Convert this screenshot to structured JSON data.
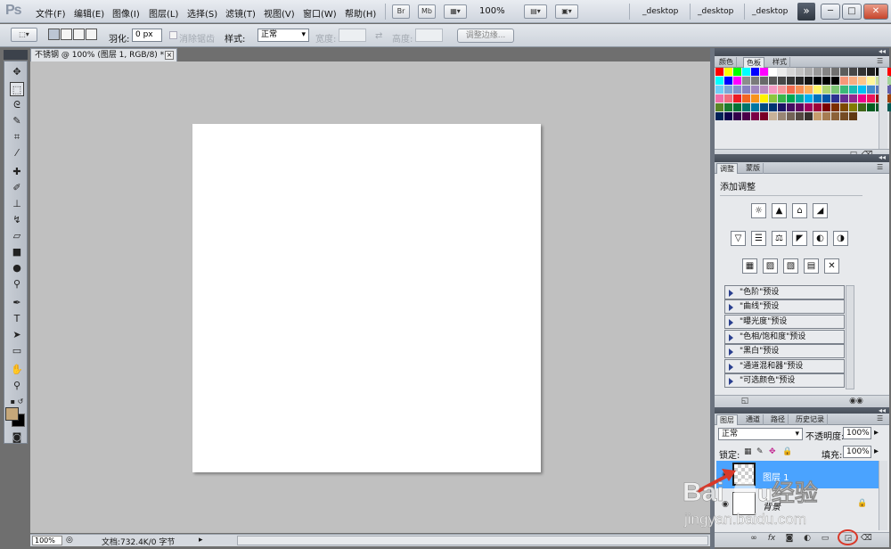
{
  "app": {
    "logo": "Ps"
  },
  "menu": {
    "items": [
      "文件(F)",
      "编辑(E)",
      "图像(I)",
      "图层(L)",
      "选择(S)",
      "滤镜(T)",
      "视图(V)",
      "窗口(W)",
      "帮助(H)"
    ],
    "bridge": "Br",
    "minibridge": "Mb",
    "zoom": "100%",
    "workspaces": [
      "_desktop",
      "_desktop",
      "_desktop"
    ],
    "expander": "»",
    "window_buttons": [
      "─",
      "□",
      "✕"
    ]
  },
  "options": {
    "feather_label": "羽化:",
    "feather_value": "0 px",
    "antialias_label": "消除锯齿",
    "style_label": "样式:",
    "style_value": "正常",
    "width_label": "宽度:",
    "height_label": "高度:",
    "refine_button": "调整边缘..."
  },
  "document": {
    "tab_title": "不锈钢 @ 100% (图层 1, RGB/8) *",
    "close_glyph": "×",
    "status_zoom": "100%",
    "status_doc": "文档:732.4K/0 字节",
    "status_arrow": "▸"
  },
  "swatches_panel": {
    "tabs": [
      "颜色",
      "色板",
      "样式"
    ],
    "active_tab": 1,
    "colors": [
      "#ff0000",
      "#ffff00",
      "#00ff00",
      "#00ffff",
      "#0000ff",
      "#ff00ff",
      "#ffffff",
      "#ebebeb",
      "#d6d6d6",
      "#c2c2c2",
      "#adadad",
      "#999999",
      "#858585",
      "#707070",
      "#5c5c5c",
      "#474747",
      "#333333",
      "#1f1f1f",
      "#000000",
      "#ff0000",
      "#ffff00",
      "#00ff00",
      "#00ffff",
      "#0000ff",
      "#ff00ff",
      "#8c8c8c",
      "#7a7a7a",
      "#696969",
      "#575757",
      "#474747",
      "#363636",
      "#262626",
      "#141414",
      "#000000",
      "#000000",
      "#000000",
      "#f7977a",
      "#f9ad81",
      "#fdc68a",
      "#fff79a",
      "#c4df9b",
      "#a3d39c",
      "#82ca9d",
      "#7bcdc8",
      "#6ecff6",
      "#7ea7d8",
      "#8493ca",
      "#8882be",
      "#a187be",
      "#bc8dbf",
      "#f49ac2",
      "#f6989d",
      "#f26c4f",
      "#f68e55",
      "#fbaf5c",
      "#fff467",
      "#acd372",
      "#7cc576",
      "#3bb878",
      "#1abbb4",
      "#00bff3",
      "#438ccb",
      "#5574b9",
      "#605ca8",
      "#855fa8",
      "#a763a8",
      "#f06ea9",
      "#f26d7d",
      "#ed1c24",
      "#f26522",
      "#f7941d",
      "#fff200",
      "#8dc63f",
      "#39b54a",
      "#00a651",
      "#00a99d",
      "#00aeef",
      "#0072bc",
      "#0054a6",
      "#2e3192",
      "#662d91",
      "#92278f",
      "#ec008c",
      "#ed145b",
      "#9e0b0f",
      "#a0410d",
      "#a36209",
      "#aba000",
      "#598527",
      "#1a7b30",
      "#007236",
      "#00746b",
      "#0076a3",
      "#004b80",
      "#003471",
      "#1b1464",
      "#440e62",
      "#630460",
      "#9e005d",
      "#9e0039",
      "#790000",
      "#7b2e00",
      "#7d4900",
      "#827b00",
      "#406618",
      "#005e20",
      "#005826",
      "#005952",
      "#005b7f",
      "#003663",
      "#002157",
      "#0d004c",
      "#32004b",
      "#4b0049",
      "#7b0046",
      "#7a0026",
      "#c7b299",
      "#998675",
      "#736357",
      "#534741",
      "#37302d",
      "#c69c6d",
      "#a67c52",
      "#8c6239",
      "#754c24",
      "#603913"
    ],
    "footer_icons": [
      "new-swatch",
      "delete-swatch"
    ]
  },
  "adjustments_panel": {
    "tabs": [
      "调整",
      "蒙版"
    ],
    "active_tab": 0,
    "title": "添加调整",
    "icon_rows": [
      [
        "☼",
        "▲",
        "⌂",
        "◢"
      ],
      [
        "▽",
        "☰",
        "⚖",
        "◤",
        "◐",
        "◑"
      ],
      [
        "▦",
        "▨",
        "▧",
        "▤",
        "✕"
      ]
    ],
    "presets": [
      "\"色阶\"预设",
      "\"曲线\"预设",
      "\"曝光度\"预设",
      "\"色相/饱和度\"预设",
      "\"黑白\"预设",
      "\"通道混和器\"预设",
      "\"可选颜色\"预设"
    ]
  },
  "layers_panel": {
    "tabs": [
      "图层",
      "通道",
      "路径",
      "历史记录"
    ],
    "active_tab": 0,
    "blend_mode": "正常",
    "opacity_label": "不透明度:",
    "opacity_value": "100%",
    "lock_label": "锁定:",
    "fill_label": "填充:",
    "fill_value": "100%",
    "layers": [
      {
        "name": "图层 1",
        "selected": true
      },
      {
        "name": "背景",
        "selected": false
      }
    ],
    "footer_icons": [
      "link",
      "fx",
      "mask",
      "adjustment",
      "group",
      "new-layer",
      "delete"
    ]
  },
  "watermark": {
    "text": "Baidu经验",
    "url_text": "jingyan.baidu.com"
  },
  "colors": {
    "highlight_blue": "#4aa3ff",
    "foreground": "#c5a77a",
    "background": "#000000",
    "annotation_red": "#d8392a"
  }
}
